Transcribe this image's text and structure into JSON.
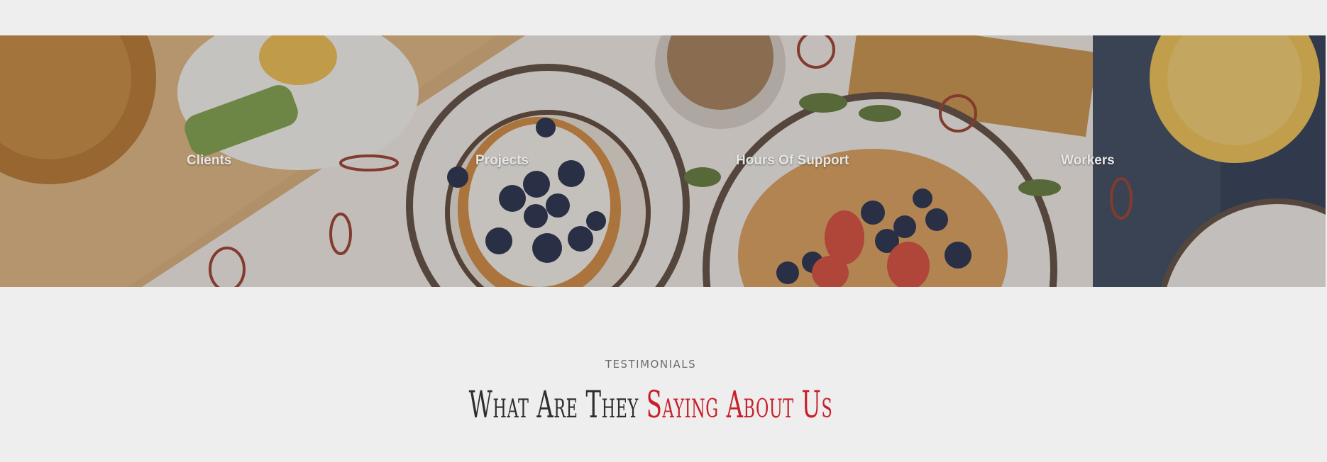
{
  "stats": {
    "items": [
      {
        "label": "Clients"
      },
      {
        "label": "Projects"
      },
      {
        "label": "Hours Of Support"
      },
      {
        "label": "Workers"
      }
    ],
    "background_image": "breakfast-table-waffles-blueberries-eggs-juice"
  },
  "testimonials": {
    "eyebrow": "TESTIMONIALS",
    "title_part1": "What Are They",
    "title_part2": "Saying About Us",
    "title_color": "#2e2e2e",
    "accent_color": "#c8202b"
  }
}
